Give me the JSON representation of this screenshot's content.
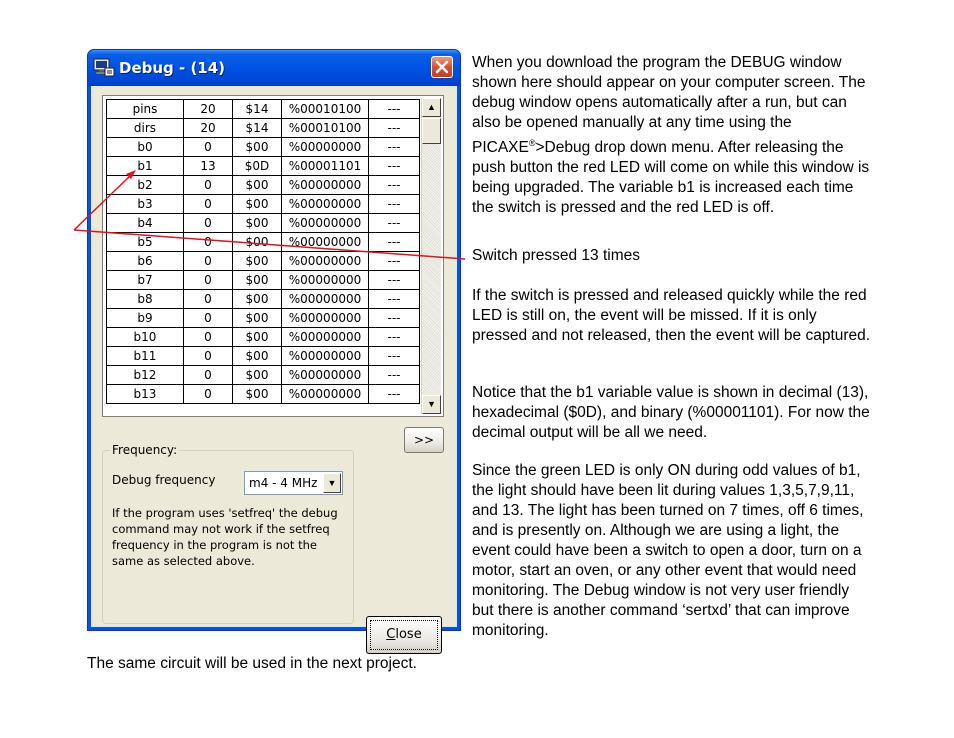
{
  "window": {
    "title": "Debug - (14)",
    "colors": {
      "titlebar": "#0055e5",
      "client": "#ece9d8",
      "close": "#d9502c"
    }
  },
  "variables": {
    "rows": [
      [
        "pins",
        "20",
        "$14",
        "%00010100",
        "---"
      ],
      [
        "dirs",
        "20",
        "$14",
        "%00010100",
        "---"
      ],
      [
        "b0",
        "0",
        "$00",
        "%00000000",
        "---"
      ],
      [
        "b1",
        "13",
        "$0D",
        "%00001101",
        "---"
      ],
      [
        "b2",
        "0",
        "$00",
        "%00000000",
        "---"
      ],
      [
        "b3",
        "0",
        "$00",
        "%00000000",
        "---"
      ],
      [
        "b4",
        "0",
        "$00",
        "%00000000",
        "---"
      ],
      [
        "b5",
        "0",
        "$00",
        "%00000000",
        "---"
      ],
      [
        "b6",
        "0",
        "$00",
        "%00000000",
        "---"
      ],
      [
        "b7",
        "0",
        "$00",
        "%00000000",
        "---"
      ],
      [
        "b8",
        "0",
        "$00",
        "%00000000",
        "---"
      ],
      [
        "b9",
        "0",
        "$00",
        "%00000000",
        "---"
      ],
      [
        "b10",
        "0",
        "$00",
        "%00000000",
        "---"
      ],
      [
        "b11",
        "0",
        "$00",
        "%00000000",
        "---"
      ],
      [
        "b12",
        "0",
        "$00",
        "%00000000",
        "---"
      ],
      [
        "b13",
        "0",
        "$00",
        "%00000000",
        "---"
      ]
    ]
  },
  "more_button": ">>",
  "frequency": {
    "group_title": "Frequency:",
    "label": "Debug frequency",
    "selected": "m4 - 4 MHz",
    "note": "If the program uses 'setfreq' the debug command may not work if the setfreq frequency in the program is not the same as selected above."
  },
  "close_button": {
    "first_letter": "C",
    "rest": "lose"
  },
  "text": {
    "p1a": "When you download the program the DEBUG window shown here should appear on your computer screen. The debug window opens automatically after a run, but can also be opened manually at any time using the PICAXE",
    "p1reg": "®",
    "p1b": ">Debug drop down menu. After releasing the push button the red LED will come on while this window is being upgraded. The variable b1 is increased each time the switch is pressed and the red LED is off.",
    "p2": "Switch pressed 13 times",
    "p3": "If the switch is pressed and released quickly while the red LED is still on, the event will be missed. If it is only pressed and not released, then the event will be captured.",
    "p4": "Notice that the b1 variable value is shown in decimal (13), hexadecimal ($0D), and binary (%00001101). For now the decimal output will be all we need.",
    "p5": "Since the green LED is only ON during odd values of b1, the light should have been lit during values 1,3,5,7,9,11, and 13. The light has been turned on 7 times, off 6 times, and is presently on. Although we are using a light, the event could have been a switch to open a door, turn on a motor, start an oven, or any other event that would need monitoring. The Debug window is not very user friendly but there is another command ‘sertxd’ that can improve monitoring.",
    "footer": "The same circuit will be used in the next project."
  },
  "annotation": {
    "color": "#e8101a"
  }
}
